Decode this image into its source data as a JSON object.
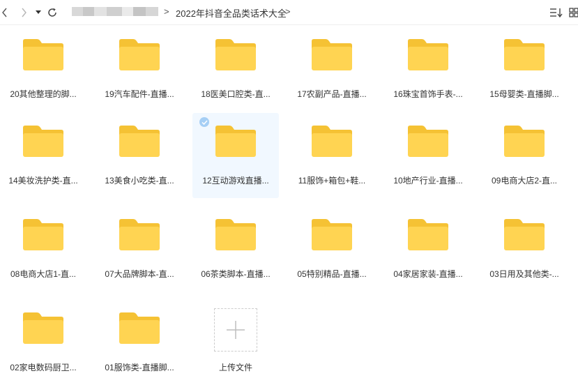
{
  "toolbar": {
    "breadcrumb": {
      "separator": ">",
      "current": "2022年抖音全品类话术大全"
    }
  },
  "colors": {
    "folder_body": "#ffd452",
    "folder_tab": "#f5c234",
    "selected_bg": "#f1f8ff",
    "check": "#a6cff5"
  },
  "folders": [
    {
      "label": "20其他整理的脚..."
    },
    {
      "label": "19汽车配件-直播..."
    },
    {
      "label": "18医美口腔类-直..."
    },
    {
      "label": "17农副产品-直播..."
    },
    {
      "label": "16珠宝首饰手表-..."
    },
    {
      "label": "15母婴类-直播脚..."
    },
    {
      "label": "14美妆洗护类-直..."
    },
    {
      "label": "13美食小吃类-直..."
    },
    {
      "label": "12互动游戏直播...",
      "selected": true
    },
    {
      "label": "11服饰+箱包+鞋..."
    },
    {
      "label": "10地产行业-直播..."
    },
    {
      "label": "09电商大店2-直..."
    },
    {
      "label": "08电商大店1-直..."
    },
    {
      "label": "07大品牌脚本-直..."
    },
    {
      "label": "06茶类脚本-直播..."
    },
    {
      "label": "05特别精品-直播..."
    },
    {
      "label": "04家居家装-直播..."
    },
    {
      "label": "03日用及其他类-..."
    },
    {
      "label": "02家电数码厨卫..."
    },
    {
      "label": "01服饰类-直播脚..."
    }
  ],
  "upload": {
    "label": "上传文件",
    "icon": "plus-icon"
  }
}
